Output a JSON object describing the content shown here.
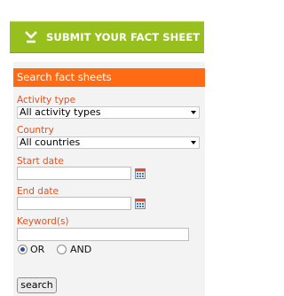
{
  "submit_button": {
    "label": "SUBMIT YOUR FACT SHEET",
    "icon": "download-arrow-icon"
  },
  "search_panel": {
    "title": "Search fact sheets",
    "activity_type": {
      "label": "Activity type",
      "selected": "All activity types"
    },
    "country": {
      "label": "Country",
      "selected": "All countries"
    },
    "start_date": {
      "label": "Start date",
      "value": "",
      "icon": "calendar-icon"
    },
    "end_date": {
      "label": "End date",
      "value": "",
      "icon": "calendar-icon"
    },
    "keywords": {
      "label": "Keyword(s)",
      "value": ""
    },
    "operator": {
      "options": [
        "OR",
        "AND"
      ],
      "selected": "OR"
    },
    "search_button": {
      "label": "search"
    }
  },
  "colors": {
    "accent_green": "#97c01e",
    "accent_orange": "#ff6a14",
    "label_orange": "#e8501b"
  }
}
